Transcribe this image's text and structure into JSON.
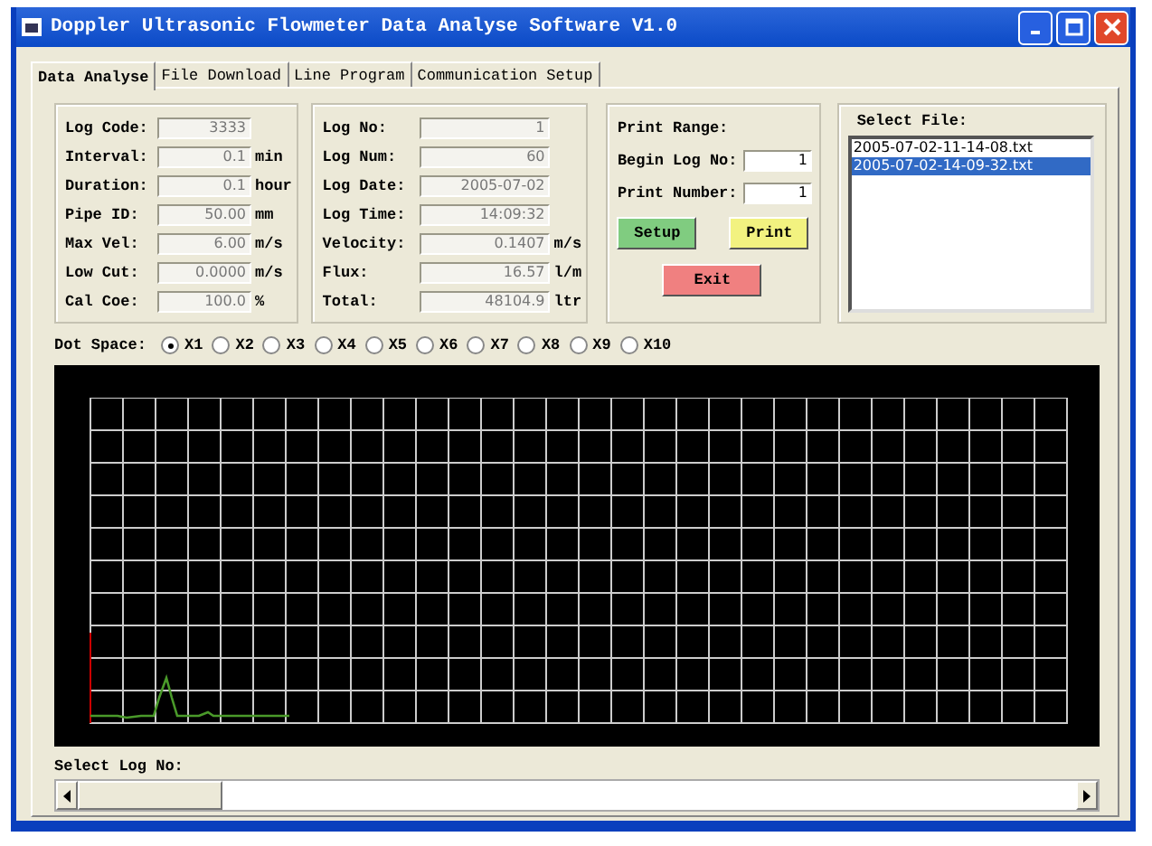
{
  "window": {
    "title": "Doppler Ultrasonic Flowmeter Data Analyse Software V1.0"
  },
  "tabs": [
    {
      "label": "Data Analyse",
      "selected": true
    },
    {
      "label": "File Download",
      "selected": false
    },
    {
      "label": "Line Program",
      "selected": false
    },
    {
      "label": "Communication Setup",
      "selected": false
    }
  ],
  "log_settings": [
    {
      "label": "Log Code:",
      "value": "3333"
    },
    {
      "label": "Interval:",
      "value": "0.1",
      "unit": "min"
    },
    {
      "label": "Duration:",
      "value": "0.1",
      "unit": "hour"
    },
    {
      "label": "Pipe ID:",
      "value": "50.00",
      "unit": "mm"
    },
    {
      "label": "Max Vel:",
      "value": "6.00",
      "unit": "m/s"
    },
    {
      "label": "Low Cut:",
      "value": "0.0000",
      "unit": "m/s"
    },
    {
      "label": "Cal Coe:",
      "value": "100.0",
      "unit": "%"
    }
  ],
  "log_record": [
    {
      "label": "Log No:",
      "value": "1"
    },
    {
      "label": "Log Num:",
      "value": "60"
    },
    {
      "label": "Log Date:",
      "value": "2005-07-02"
    },
    {
      "label": "Log Time:",
      "value": "14:09:32"
    },
    {
      "label": "Velocity:",
      "value": "0.1407",
      "unit": "m/s"
    },
    {
      "label": "Flux:",
      "value": "16.57",
      "unit": "l/m"
    },
    {
      "label": "Total:",
      "value": "48104.9",
      "unit": "ltr"
    }
  ],
  "print": {
    "title": "Print Range:",
    "fields": [
      {
        "label": "Begin Log No:",
        "value": "1"
      },
      {
        "label": "Print Number:",
        "value": "1"
      }
    ],
    "buttons": [
      {
        "label": "Setup",
        "kind": "setup"
      },
      {
        "label": "Print",
        "kind": "print"
      },
      {
        "label": "Exit",
        "kind": "exit"
      }
    ]
  },
  "select_file": {
    "title": "Select File:",
    "files": [
      {
        "name": "2005-07-02-11-14-08.txt",
        "selected": false
      },
      {
        "name": "2005-07-02-14-09-32.txt",
        "selected": true
      }
    ]
  },
  "dot_space": {
    "label": "Dot Space:",
    "options": [
      {
        "label": "X1",
        "selected": true
      },
      {
        "label": "X2",
        "selected": false
      },
      {
        "label": "X3",
        "selected": false
      },
      {
        "label": "X4",
        "selected": false
      },
      {
        "label": "X5",
        "selected": false
      },
      {
        "label": "X6",
        "selected": false
      },
      {
        "label": "X7",
        "selected": false
      },
      {
        "label": "X8",
        "selected": false
      },
      {
        "label": "X9",
        "selected": false
      },
      {
        "label": "X10",
        "selected": false
      }
    ]
  },
  "select_log": {
    "label": "Select Log No:"
  }
}
